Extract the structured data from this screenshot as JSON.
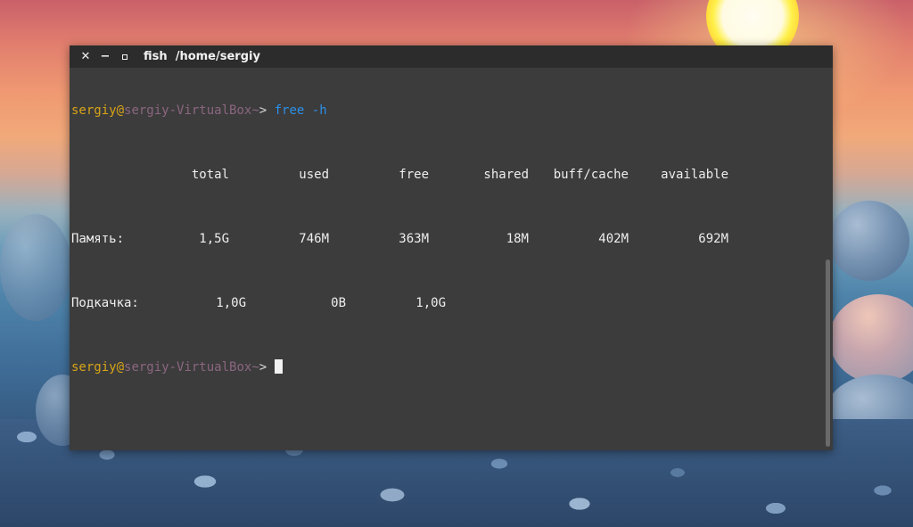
{
  "window": {
    "title_app": "fish",
    "title_path": "/home/sergiy"
  },
  "prompt": {
    "user": "sergiy",
    "at": "@",
    "host": "sergiy-VirtualBox",
    "cwd": "~",
    "arrow": "> "
  },
  "command": {
    "name": "free",
    "arg": "-h"
  },
  "free_output": {
    "headers": [
      "total",
      "used",
      "free",
      "shared",
      "buff/cache",
      "available"
    ],
    "rows": [
      {
        "label": "Память:",
        "values": [
          "1,5G",
          "746M",
          "363M",
          "18M",
          "402M",
          "692M"
        ]
      },
      {
        "label": "Подкачка:",
        "values": [
          "1,0G",
          "0B",
          "1,0G"
        ]
      }
    ]
  },
  "colors": {
    "terminal_bg": "#3c3c3c",
    "titlebar_bg": "#2c2c2c",
    "user_color": "#d7a418",
    "host_color": "#8b6680",
    "command_color": "#2b8fe8"
  }
}
